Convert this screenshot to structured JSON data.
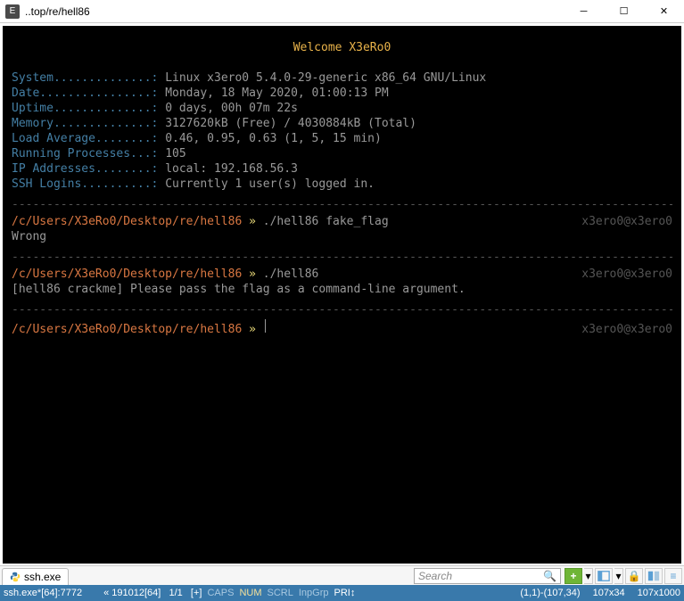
{
  "window": {
    "title": "..top/re/hell86",
    "icon_letter": "E"
  },
  "welcome": "Welcome X3eRo0",
  "info": {
    "system_label": "System..............:",
    "system_value": " Linux x3ero0 5.4.0-29-generic x86_64 GNU/Linux",
    "date_label": "Date................:",
    "date_value": " Monday, 18 May 2020, 01:00:13 PM",
    "uptime_label": "Uptime..............:",
    "uptime_value": " 0 days, 00h 07m 22s",
    "memory_label": "Memory..............:",
    "memory_value": " 3127620kB (Free) / 4030884kB (Total)",
    "load_label": "Load Average........:",
    "load_value": " 0.46, 0.95, 0.63 (1, 5, 15 min)",
    "proc_label": "Running Processes...:",
    "proc_value": " 105",
    "ip_label": "IP Addresses........:",
    "ip_value": " local: 192.168.56.3",
    "ssh_label": "SSH Logins..........:",
    "ssh_value": " Currently 1 user(s) logged in."
  },
  "divider": "--------------------------------------------------------------------------------------------------------------------",
  "session": {
    "path": "/c/Users/X3eRo0/Desktop/re/hell86",
    "arrow": " » ",
    "userhost": "x3ero0@x3ero0",
    "cmd1": "./hell86 fake_flag",
    "out1": "Wrong",
    "cmd2": "./hell86",
    "out2": "[hell86 crackme] Please pass the flag as a command-line argument."
  },
  "toolbar": {
    "tab_label": "ssh.exe",
    "search_placeholder": "Search"
  },
  "status": {
    "file": "ssh.exe*[64]:7772",
    "mid": "« 191012[64]   1/1   [+]",
    "caps": "CAPS",
    "num": "NUM",
    "scrl": "SCRL",
    "inpgrp": "InpGrp",
    "pri": "PRI↕",
    "pos": "(1,1)-(107,34)",
    "dim": "107x34",
    "buf": "107x1000"
  }
}
